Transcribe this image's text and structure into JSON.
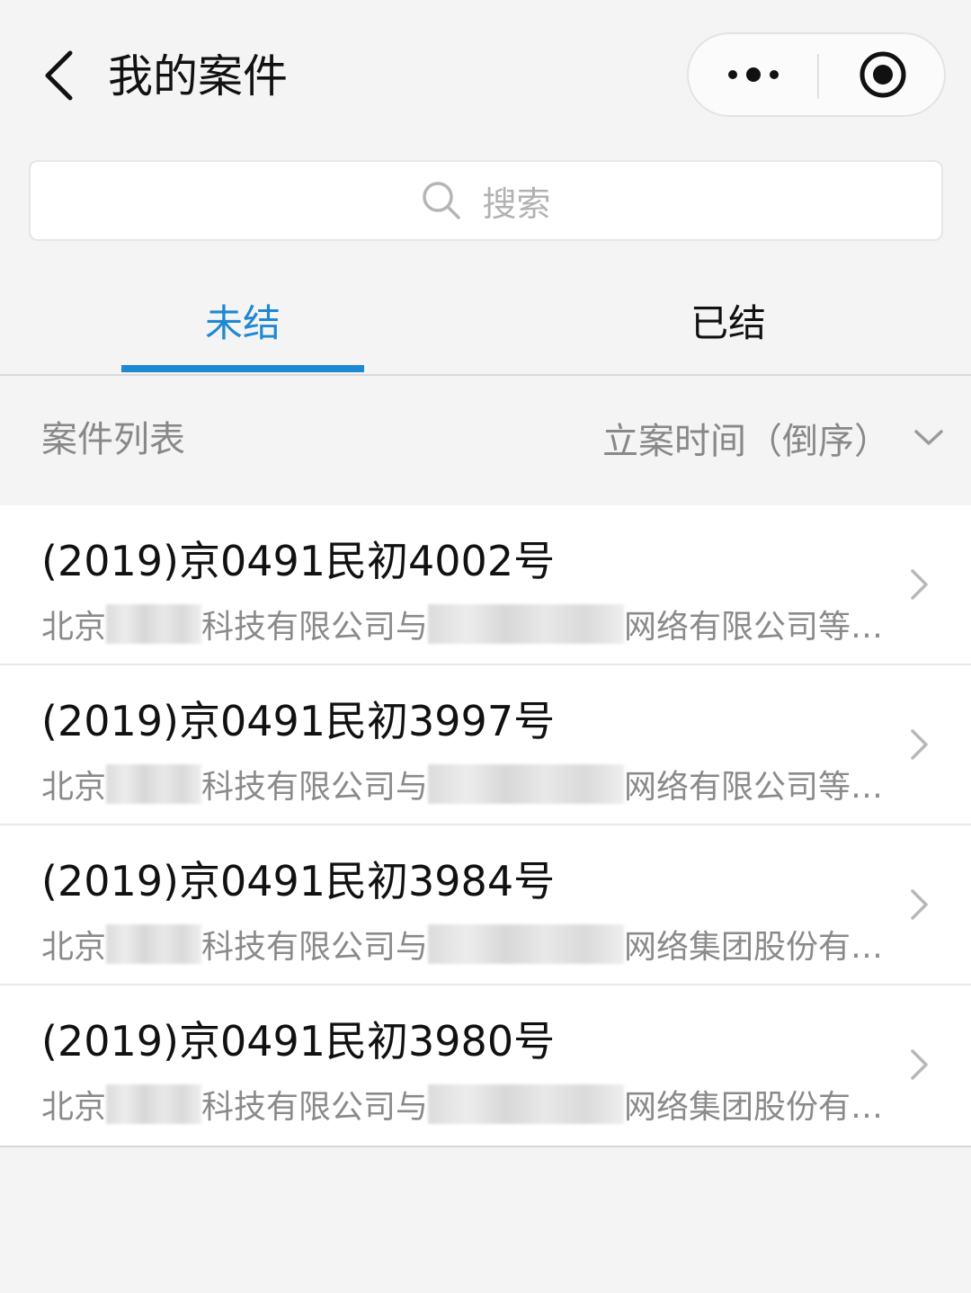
{
  "nav": {
    "title": "我的案件"
  },
  "search": {
    "placeholder": "搜索"
  },
  "tabs": [
    {
      "label": "未结",
      "active": true
    },
    {
      "label": "已结",
      "active": false
    }
  ],
  "list_header": {
    "label": "案件列表",
    "sort_label": "立案时间（倒序）"
  },
  "cases": [
    {
      "case_no": "(2019)京0491民初4002号",
      "party1_prefix": "北京",
      "party1_suffix": "科技有限公司与",
      "party2_suffix": "网络有限公司等…"
    },
    {
      "case_no": "(2019)京0491民初3997号",
      "party1_prefix": "北京",
      "party1_suffix": "科技有限公司与",
      "party2_suffix": "网络有限公司等…"
    },
    {
      "case_no": "(2019)京0491民初3984号",
      "party1_prefix": "北京",
      "party1_suffix": "科技有限公司与",
      "party2_suffix": "网络集团股份有…"
    },
    {
      "case_no": "(2019)京0491民初3980号",
      "party1_prefix": "北京",
      "party1_suffix": "科技有限公司与",
      "party2_suffix": "网络集团股份有…"
    }
  ],
  "colors": {
    "accent": "#1f88d2",
    "background": "#f4f4f4",
    "secondary_text": "#8a8a8a"
  }
}
